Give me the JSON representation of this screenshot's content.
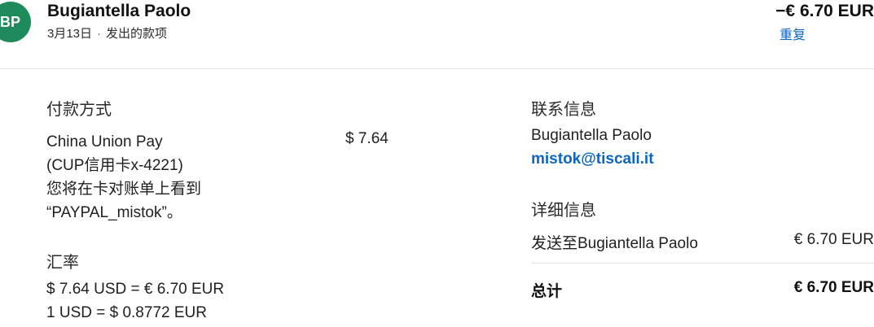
{
  "header": {
    "avatar_initials": "BP",
    "avatar_color": "#1f8a5a",
    "merchant_name": "Bugiantella Paolo",
    "date": "3月13日",
    "separator": "·",
    "type": "发出的款项",
    "amount": "−€ 6.70 EUR",
    "repeat_link": "重复"
  },
  "payment_method": {
    "label": "付款方式",
    "lines": [
      "China Union Pay",
      "(CUP信用卡x-4221)",
      "您将在卡对账单上看到",
      "“PAYPAL_mistok”。"
    ],
    "amount": "$ 7.64"
  },
  "exchange_rate": {
    "label": "汇率",
    "line1": "$ 7.64 USD = € 6.70 EUR",
    "line2": "1 USD = $ 0.8772 EUR"
  },
  "contact": {
    "label": "联系信息",
    "name": "Bugiantella Paolo",
    "email": "mistok@tiscali.it"
  },
  "details": {
    "label": "详细信息",
    "sent_to_label": "发送至Bugiantella Paolo",
    "sent_to_amount": "€ 6.70 EUR",
    "total_label": "总计",
    "total_amount": "€ 6.70 EUR"
  },
  "colors": {
    "link": "#0a66c2",
    "divider": "#e2e2e2"
  }
}
